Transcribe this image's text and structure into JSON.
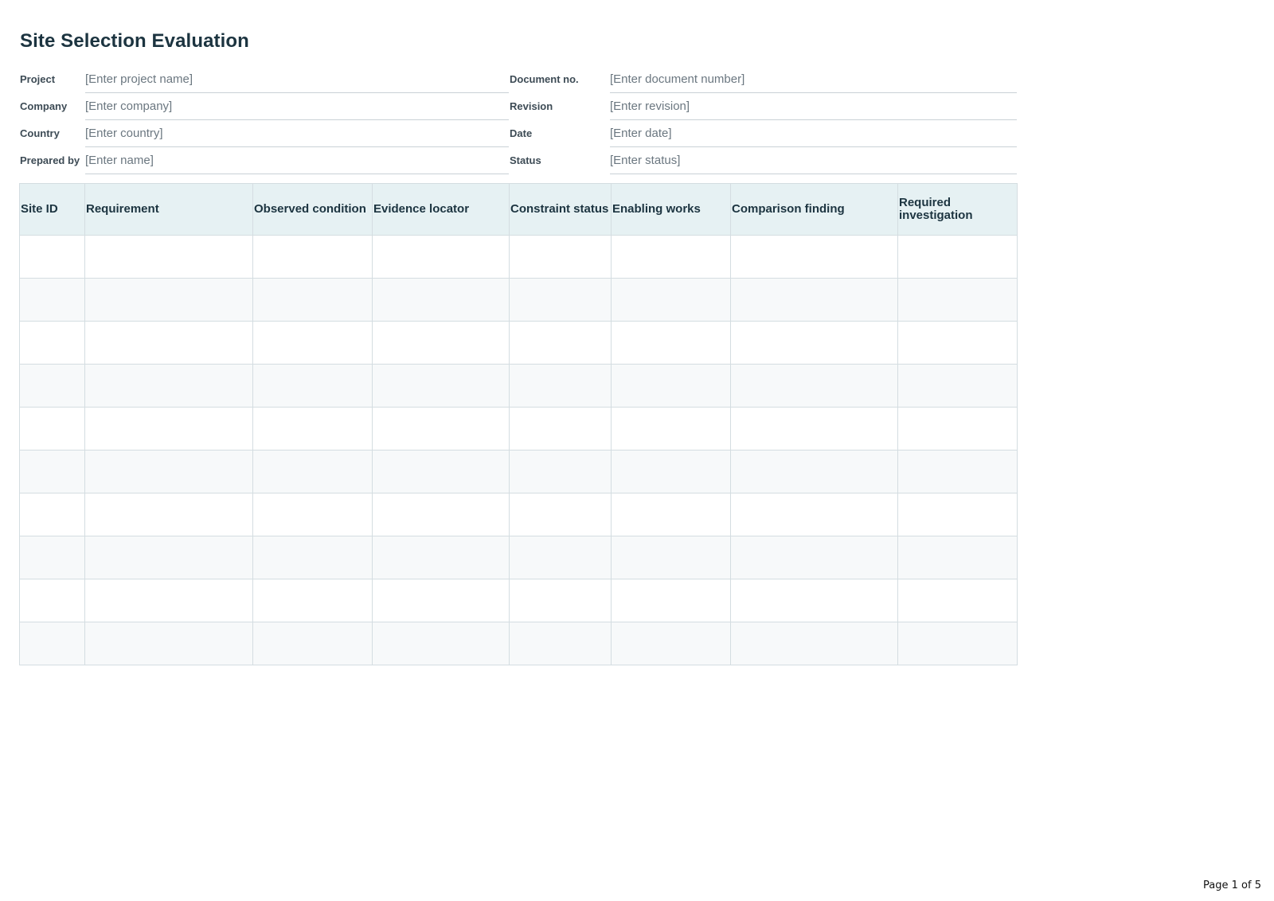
{
  "document": {
    "title": "Site Selection Evaluation"
  },
  "meta_left": [
    {
      "label": "Project",
      "value": "[Enter project name]"
    },
    {
      "label": "Company",
      "value": "[Enter company]"
    },
    {
      "label": "Country",
      "value": "[Enter country]"
    },
    {
      "label": "Prepared by",
      "value": "[Enter name]"
    }
  ],
  "meta_right": [
    {
      "label": "Document no.",
      "value": "[Enter document number]"
    },
    {
      "label": "Revision",
      "value": "[Enter revision]"
    },
    {
      "label": "Date",
      "value": "[Enter date]"
    },
    {
      "label": "Status",
      "value": "[Enter status]"
    }
  ],
  "table": {
    "headers": [
      "Site ID",
      "Requirement",
      "Observed condition",
      "Evidence locator",
      "Constraint status",
      "Enabling works",
      "Comparison finding",
      "Required investigation"
    ],
    "rows": [
      [
        "",
        "",
        "",
        "",
        "",
        "",
        "",
        ""
      ],
      [
        "",
        "",
        "",
        "",
        "",
        "",
        "",
        ""
      ],
      [
        "",
        "",
        "",
        "",
        "",
        "",
        "",
        ""
      ],
      [
        "",
        "",
        "",
        "",
        "",
        "",
        "",
        ""
      ],
      [
        "",
        "",
        "",
        "",
        "",
        "",
        "",
        ""
      ],
      [
        "",
        "",
        "",
        "",
        "",
        "",
        "",
        ""
      ],
      [
        "",
        "",
        "",
        "",
        "",
        "",
        "",
        ""
      ],
      [
        "",
        "",
        "",
        "",
        "",
        "",
        "",
        ""
      ],
      [
        "",
        "",
        "",
        "",
        "",
        "",
        "",
        ""
      ],
      [
        "",
        "",
        "",
        "",
        "",
        "",
        "",
        ""
      ]
    ]
  },
  "footer": {
    "page_label": "Page 1 of 5"
  }
}
